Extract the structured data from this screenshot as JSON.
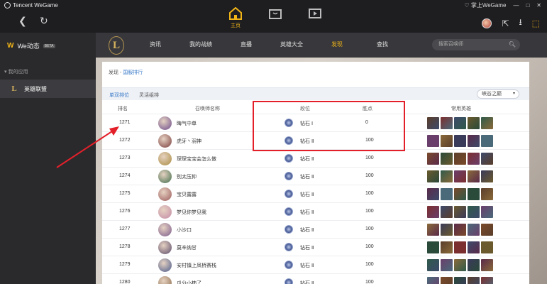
{
  "topbar": {
    "brand": "Tencent WeGame",
    "home_label": "主页",
    "login_label": "掌上WeGame",
    "win_min": "—",
    "win_max": "□",
    "win_close": "✕"
  },
  "sidebar": {
    "we_title": "We动态",
    "we_badge": "BETA",
    "my_apps": "我的应用",
    "apps": [
      {
        "label": "英雄联盟"
      }
    ]
  },
  "lol_nav": {
    "items": [
      {
        "label": "资讯"
      },
      {
        "label": "我的战绩"
      },
      {
        "label": "直播"
      },
      {
        "label": "英雄大全"
      },
      {
        "label": "发现",
        "active": true
      },
      {
        "label": "查找"
      }
    ],
    "search_placeholder": "搜索召唤师"
  },
  "breadcrumb": {
    "root": "发现",
    "sep": " - ",
    "current": "国服排行"
  },
  "subtabs": [
    {
      "label": "单双排位",
      "active": true
    },
    {
      "label": "灵活组排"
    }
  ],
  "region": "峡谷之巅",
  "table": {
    "headers": {
      "rank": "排名",
      "name": "召唤师名称",
      "tier": "段位",
      "points": "胜点",
      "heroes": "常用英雄"
    },
    "rows": [
      {
        "rank": "1271",
        "name": "晦气中单",
        "tier": "钻石 Ⅰ",
        "points": "0"
      },
      {
        "rank": "1272",
        "name": "虎牙丶羽神",
        "tier": "钻石 Ⅱ",
        "points": "100"
      },
      {
        "rank": "1273",
        "name": "琛琛宝宝会怎么做",
        "tier": "钻石 Ⅱ",
        "points": "100"
      },
      {
        "rank": "1274",
        "name": "别太压抑",
        "tier": "钻石 Ⅱ",
        "points": "100"
      },
      {
        "rank": "1275",
        "name": "宝贝露露",
        "tier": "钻石 Ⅱ",
        "points": "100"
      },
      {
        "rank": "1276",
        "name": "梦见你梦见我",
        "tier": "钻石 Ⅱ",
        "points": "100"
      },
      {
        "rank": "1277",
        "name": "小沙口",
        "tier": "钻石 Ⅱ",
        "points": "100"
      },
      {
        "rank": "1278",
        "name": "莫辛纳甘",
        "tier": "钻石 Ⅱ",
        "points": "100"
      },
      {
        "rank": "1279",
        "name": "安村镇上凤桥赛栈",
        "tier": "钻石 Ⅱ",
        "points": "100"
      },
      {
        "rank": "1280",
        "name": "瓜分小柿了",
        "tier": "钻石 Ⅱ",
        "points": "100"
      }
    ]
  },
  "colors": {
    "accent": "#f0b417",
    "link": "#3b7bc8",
    "highlight": "#e3202a"
  }
}
